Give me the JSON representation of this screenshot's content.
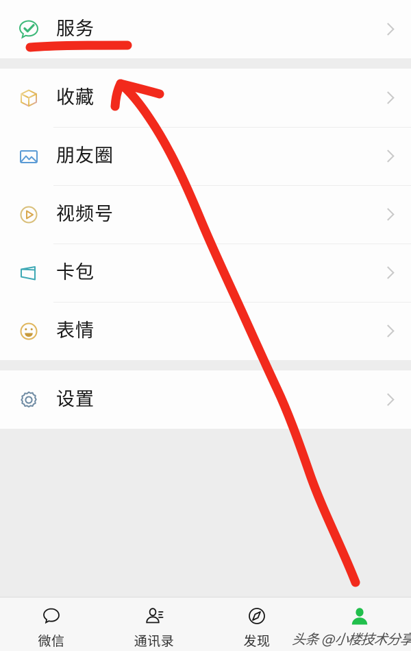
{
  "app": {
    "name": "WeChat Me page",
    "background_color": "#ededed",
    "card_color": "#fdfdfd",
    "accent_green": "#07c160",
    "annotation_color": "#f22a1c"
  },
  "sections": [
    {
      "id": "services",
      "items": [
        {
          "label": "服务",
          "icon": "services-chat-check-icon",
          "icon_color": "#3cb878"
        }
      ]
    },
    {
      "id": "content",
      "items": [
        {
          "label": "收藏",
          "icon": "favorites-cube-icon",
          "icon_color": "#e8c15a"
        },
        {
          "label": "朋友圈",
          "icon": "moments-photo-icon",
          "icon_color": "#5b9bd5"
        },
        {
          "label": "视频号",
          "icon": "channels-play-icon",
          "icon_color": "#d9bf7a"
        },
        {
          "label": "卡包",
          "icon": "cards-wallet-icon",
          "icon_color": "#3fa9b5"
        },
        {
          "label": "表情",
          "icon": "stickers-smiley-icon",
          "icon_color": "#e0b65c"
        }
      ]
    },
    {
      "id": "settings",
      "items": [
        {
          "label": "设置",
          "icon": "settings-gear-icon",
          "icon_color": "#6f8ba3"
        }
      ]
    }
  ],
  "tabbar": {
    "tabs": [
      {
        "label": "微信",
        "icon": "chat-bubble-icon",
        "active": false
      },
      {
        "label": "通讯录",
        "icon": "contacts-icon",
        "active": false
      },
      {
        "label": "发现",
        "icon": "compass-icon",
        "active": false
      },
      {
        "label": "",
        "icon": "profile-person-icon",
        "active": true
      }
    ]
  },
  "watermark": {
    "text": "头条 @小楼技术分享"
  },
  "annotations": [
    {
      "name": "underline-under-services",
      "type": "stroke",
      "color": "#f22a1c"
    },
    {
      "name": "arrow-pointing-to-favorites",
      "type": "arrow",
      "color": "#f22a1c"
    }
  ]
}
